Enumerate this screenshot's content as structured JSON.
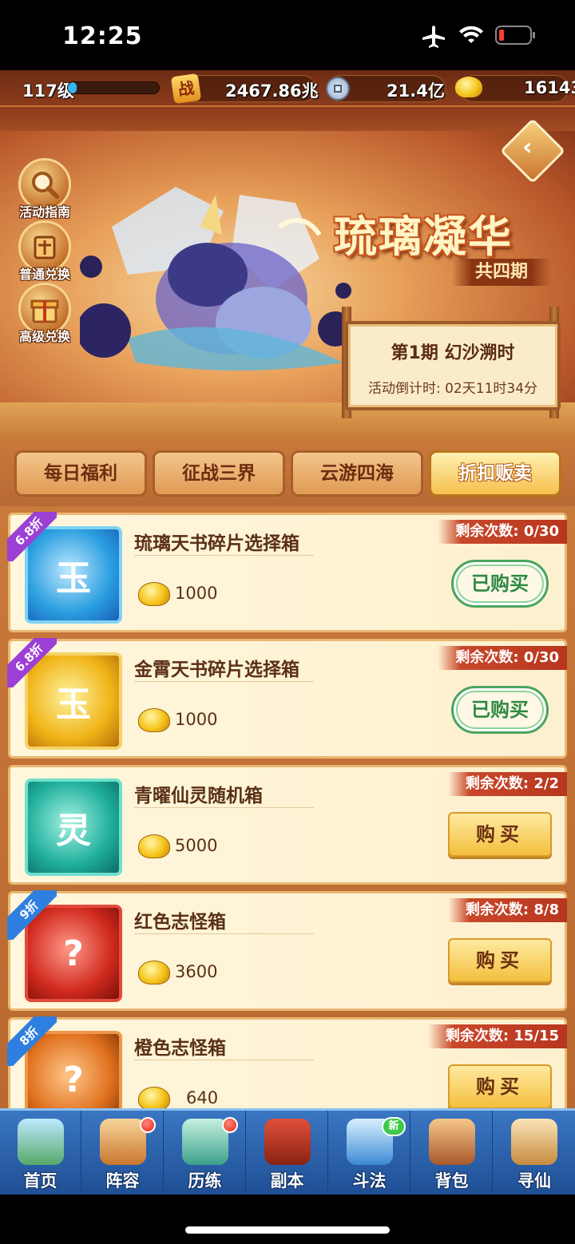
{
  "status_bar": {
    "time": "12:25"
  },
  "resources": {
    "level": "117级",
    "level_progress": 0.1,
    "battle_power": "2467.86兆",
    "silver": "21.4亿",
    "gold": "16143"
  },
  "banner": {
    "title": "琉璃凝华",
    "subtitle": "共四期",
    "period_title": "第1期  幻沙溯时",
    "countdown": "活动倒计时: 02天11时34分",
    "side_buttons": [
      {
        "label": "活动指南"
      },
      {
        "label": "普通兑换"
      },
      {
        "label": "高级兑换"
      }
    ]
  },
  "tabs": [
    {
      "label": "每日福利",
      "active": false
    },
    {
      "label": "征战三界",
      "active": false
    },
    {
      "label": "云游四海",
      "active": false
    },
    {
      "label": "折扣贩卖",
      "active": true
    }
  ],
  "items": [
    {
      "name": "琉璃天书碎片选择箱",
      "price": "1000",
      "remaining": "剩余次数: 0/30",
      "discount": "6.8折",
      "button": "已购买",
      "bought": true,
      "icon_glyph": "玉"
    },
    {
      "name": "金霄天书碎片选择箱",
      "price": "1000",
      "remaining": "剩余次数: 0/30",
      "discount": "6.8折",
      "button": "已购买",
      "bought": true,
      "icon_glyph": "玉"
    },
    {
      "name": "青曜仙灵随机箱",
      "price": "5000",
      "remaining": "剩余次数: 2/2",
      "discount": "",
      "button": "购买",
      "bought": false,
      "icon_glyph": "灵"
    },
    {
      "name": "红色志怪箱",
      "price": "3600",
      "remaining": "剩余次数: 8/8",
      "discount": "9折",
      "button": "购买",
      "bought": false,
      "icon_glyph": "?"
    },
    {
      "name": "橙色志怪箱",
      "price": "640",
      "remaining": "剩余次数: 15/15",
      "discount": "8折",
      "button": "购买",
      "bought": false,
      "icon_glyph": "?"
    }
  ],
  "bottom_nav": [
    {
      "label": "首页",
      "badge": ""
    },
    {
      "label": "阵容",
      "badge": "dot"
    },
    {
      "label": "历练",
      "badge": "dot"
    },
    {
      "label": "副本",
      "badge": ""
    },
    {
      "label": "斗法",
      "badge": "新"
    },
    {
      "label": "背包",
      "badge": ""
    },
    {
      "label": "寻仙",
      "badge": ""
    }
  ],
  "colors": {
    "tab_active": "#f6c04d",
    "bought_green": "#2e8a44",
    "remaining_red": "#c9472a",
    "nav_blue": "#2b5fa8"
  }
}
